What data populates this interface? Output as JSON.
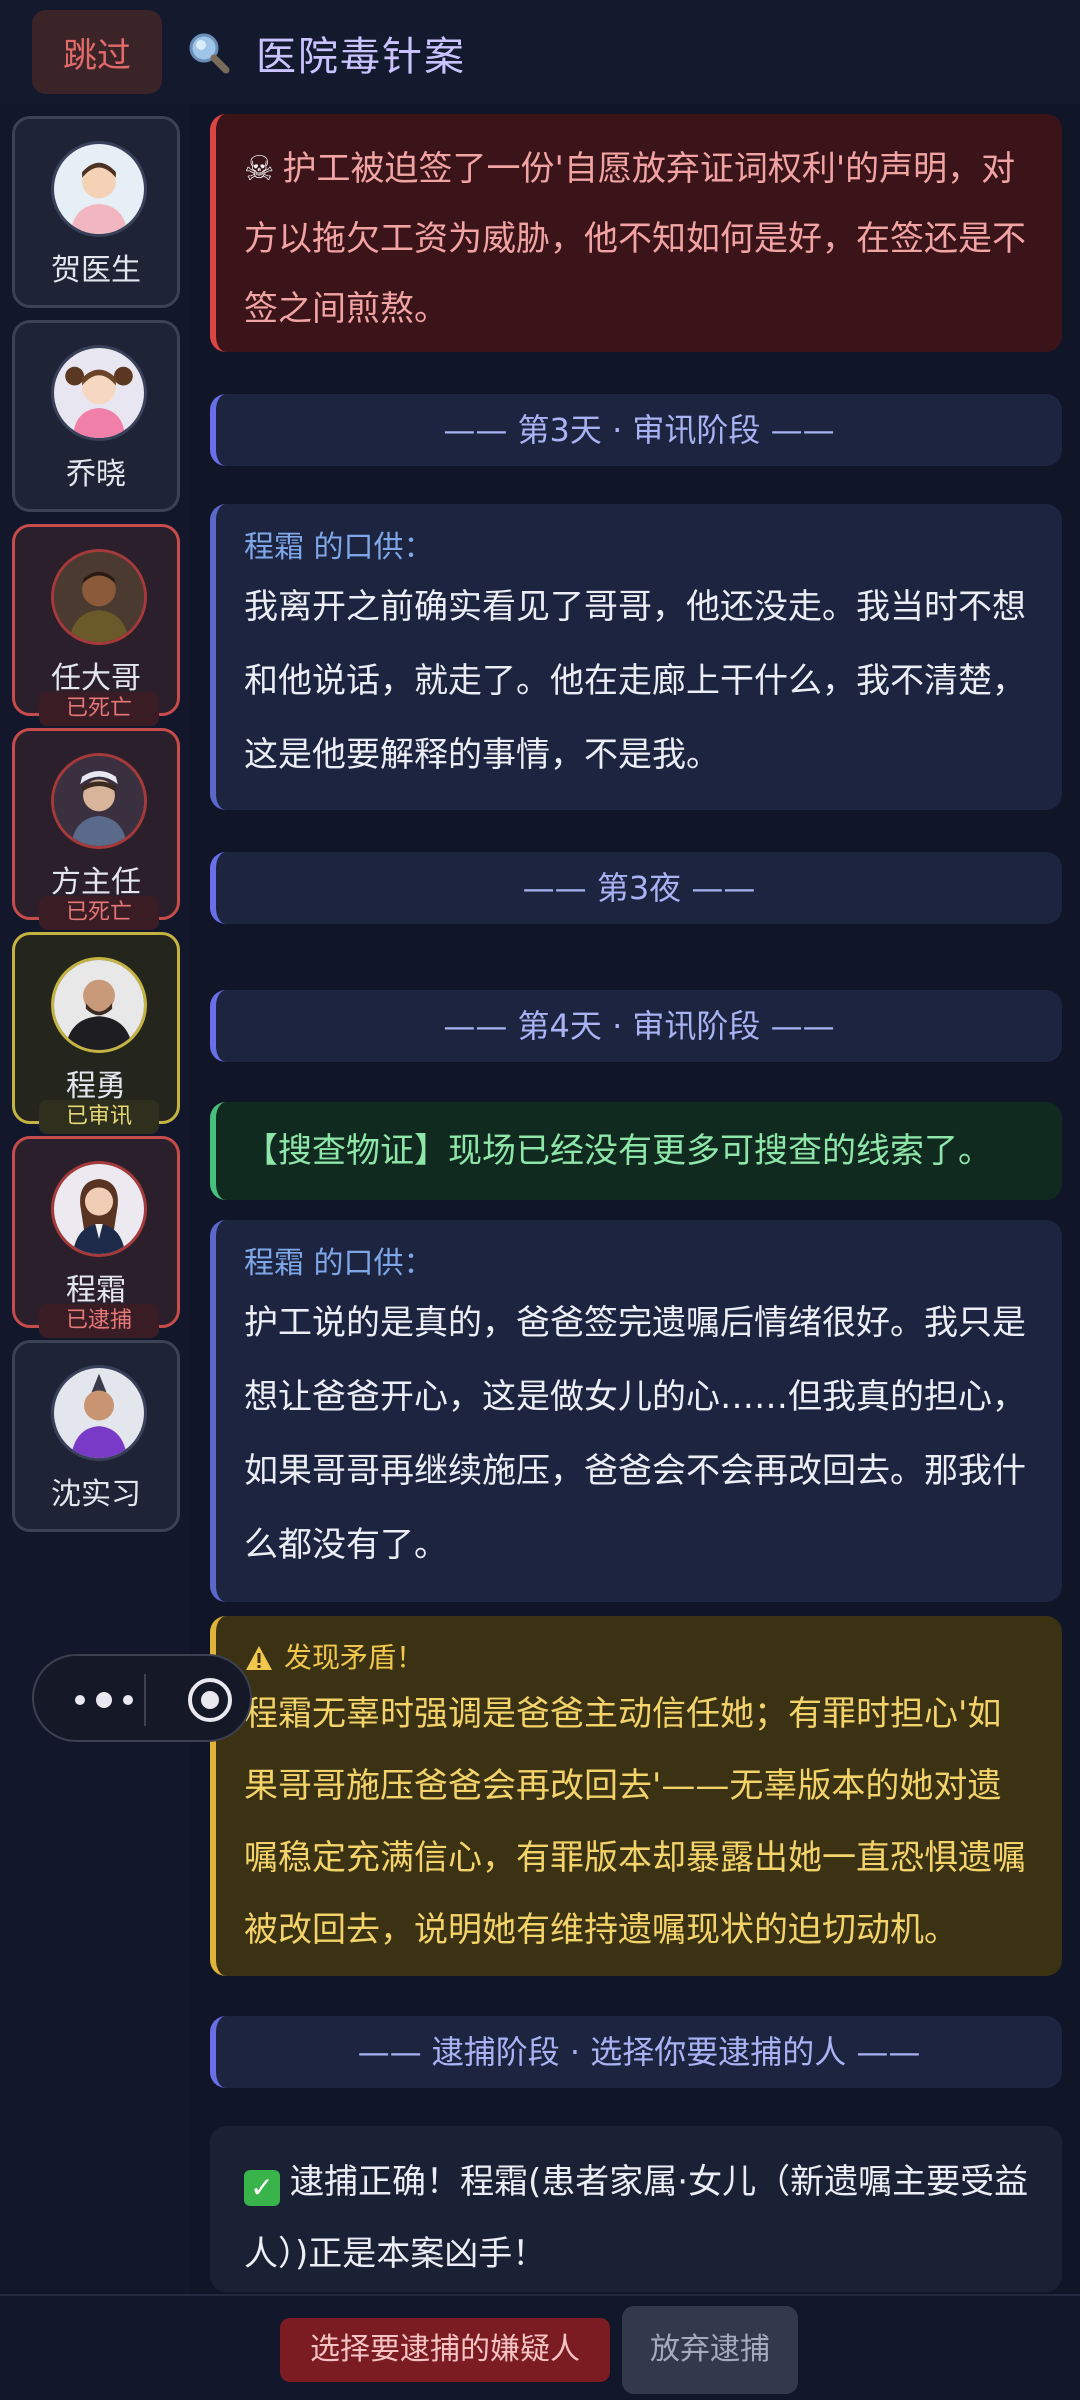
{
  "header": {
    "skip_label": "跳过",
    "case_title": "医院毒针案"
  },
  "suspects": [
    {
      "name": "贺医生",
      "status": "",
      "badge": ""
    },
    {
      "name": "乔晓",
      "status": "",
      "badge": ""
    },
    {
      "name": "任大哥",
      "status": "dead",
      "badge": "已死亡"
    },
    {
      "name": "方主任",
      "status": "dead",
      "badge": "已死亡"
    },
    {
      "name": "程勇",
      "status": "interrogated",
      "badge": "已审讯"
    },
    {
      "name": "程霜",
      "status": "arrested",
      "badge": "已逮捕"
    },
    {
      "name": "沈实习",
      "status": "",
      "badge": ""
    }
  ],
  "feed": {
    "event_1": "护工被迫签了一份'自愿放弃证词权利'的声明，对方以拖欠工资为威胁，他不知如何是好，在签还是不签之间煎熬。",
    "phase_day3": "—— 第3天 · 审讯阶段 ——",
    "testimony_1_who": "程霜 的口供：",
    "testimony_1_text": "我离开之前确实看见了哥哥，他还没走。我当时不想和他说话，就走了。他在走廊上干什么，我不清楚，这是他要解释的事情，不是我。",
    "phase_night3": "—— 第3夜 ——",
    "phase_day4": "—— 第4天 · 审讯阶段 ——",
    "search_result": "【搜查物证】现场已经没有更多可搜查的线索了。",
    "testimony_2_who": "程霜 的口供：",
    "testimony_2_text": "护工说的是真的，爸爸签完遗嘱后情绪很好。我只是想让爸爸开心，这是做女儿的心……但我真的担心，如果哥哥再继续施压，爸爸会不会再改回去。那我什么都没有了。",
    "warning_head": "发现矛盾！",
    "warning_text": "程霜无辜时强调是爸爸主动信任她；有罪时担心'如果哥哥施压爸爸会再改回去'——无辜版本的她对遗嘱稳定充满信心，有罪版本却暴露出她一直恐惧遗嘱被改回去，说明她有维持遗嘱现状的迫切动机。",
    "phase_arrest": "—— 逮捕阶段 · 选择你要逮捕的人 ——",
    "result_text": "逮捕正确！程霜(患者家属·女儿（新遗嘱主要受益人）)正是本案凶手！"
  },
  "bottom": {
    "arrest_label": "选择要逮捕的嫌疑人",
    "abandon_label": "放弃逮捕"
  },
  "colors": {
    "background": "#111528",
    "danger": "#d44444",
    "phase_accent": "#6a6ee8",
    "search_accent": "#46c07a",
    "warning_accent": "#e0b43a"
  }
}
